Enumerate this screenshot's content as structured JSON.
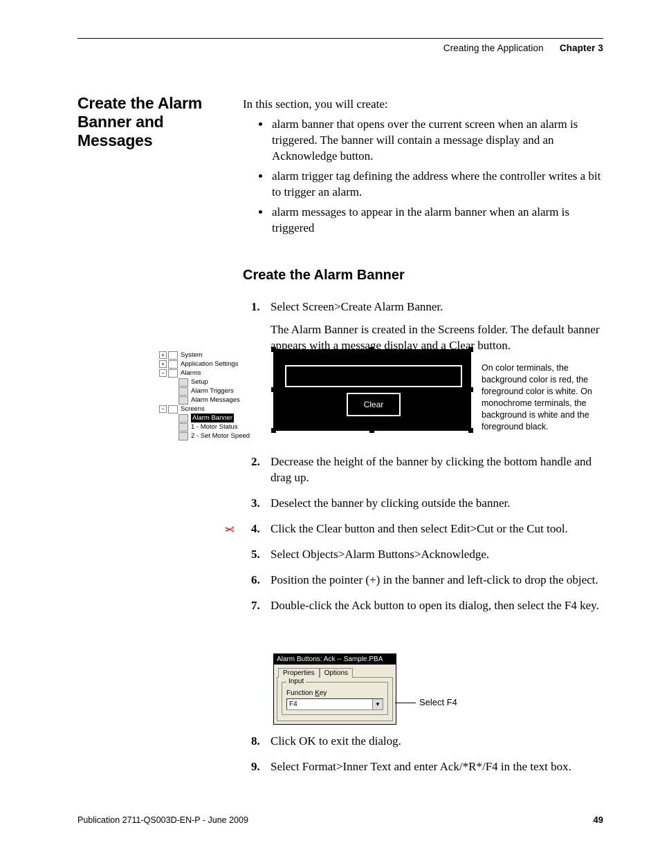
{
  "header": {
    "breadcrumb": "Creating the Application",
    "chapter": "Chapter 3"
  },
  "section_title": "Create the Alarm Banner and Messages",
  "intro": "In this section, you will create:",
  "bullets": [
    "alarm banner that opens over the current screen when an alarm is triggered. The banner will contain a message display and an Acknowledge button.",
    "alarm trigger tag defining the address where the controller writes a bit to trigger an alarm.",
    "alarm messages to appear in the alarm banner when an alarm is triggered"
  ],
  "sub_heading": "Create the Alarm Banner",
  "step1": "Select Screen>Create Alarm Banner.",
  "step1_para": "The Alarm Banner is created in the Screens folder. The default banner appears with a message display and a Clear button.",
  "tree": {
    "system": "System",
    "appsettings": "Application Settings",
    "alarms": "Alarms",
    "setup": "Setup",
    "triggers": "Alarm Triggers",
    "messages": "Alarm Messages",
    "screens": "Screens",
    "banner": "Alarm Banner",
    "motorstatus": "1 - Motor Status",
    "setmotor": "2 - Set Motor Speed"
  },
  "banner": {
    "clear": "Clear"
  },
  "banner_note": "On color terminals, the background color is red, the foreground color is white. On monochrome terminals, the background is white and the foreground black.",
  "step2": "Decrease the height of the banner by clicking the bottom handle and drag up.",
  "step3": "Deselect the banner by clicking outside the banner.",
  "step4": "Click the Clear button and then select Edit>Cut or the Cut tool.",
  "step5": "Select Objects>Alarm Buttons>Acknowledge.",
  "step6": "Position the pointer (+) in the banner and left-click to drop the object.",
  "step7": "Double-click the Ack button to open its dialog, then select the F4 key.",
  "dialog": {
    "title": "Alarm Buttons: Ack -- Sample.PBA",
    "tab_props": "Properties",
    "tab_opts": "Options",
    "group": "Input",
    "field_pre": "Function ",
    "field_key": "K",
    "field_post": "ey",
    "value": "F4",
    "callout": "Select F4"
  },
  "step8": "Click OK to exit the dialog.",
  "step9": "Select Format>Inner Text and enter Ack/*R*/F4 in the text box.",
  "footer": {
    "pub": "Publication 2711-QS003D-EN-P - June 2009",
    "page": "49"
  }
}
